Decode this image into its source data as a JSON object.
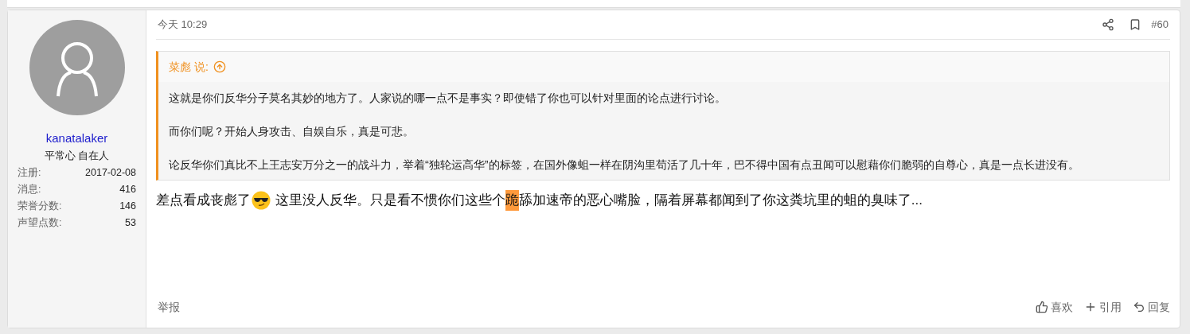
{
  "user": {
    "name": "kanatalaker",
    "title": "平常心 自在人",
    "stats": [
      {
        "label": "注册:",
        "value": "2017-02-08"
      },
      {
        "label": "消息:",
        "value": "416"
      },
      {
        "label": "荣誉分数:",
        "value": "146"
      },
      {
        "label": "声望点数:",
        "value": "53"
      }
    ]
  },
  "post": {
    "time": "今天 10:29",
    "number": "#60",
    "quote": {
      "author": "菜彪 说:",
      "paragraphs": [
        "这就是你们反华分子莫名其妙的地方了。人家说的哪一点不是事实？即使错了你也可以针对里面的论点进行讨论。",
        "而你们呢？开始人身攻击、自娱自乐，真是可悲。",
        "论反华你们真比不上王志安万分之一的战斗力，举着“独轮运高华”的标签，在国外像蛆一样在阴沟里苟活了几十年，巴不得中国有点丑闻可以慰藉你们脆弱的自尊心，真是一点长进没有。"
      ]
    },
    "body": [
      {
        "kind": "text",
        "text": "差点看成丧彪了"
      },
      {
        "kind": "emoji"
      },
      {
        "kind": "text",
        "text": " 这里没人反华。只是看不惯你们这些个"
      },
      {
        "kind": "highlight",
        "text": "跪"
      },
      {
        "kind": "text",
        "text": "舔加速帝的恶心嘴脸，隔着屏幕都闻到了你这粪坑里的蛆的臭味了..."
      }
    ],
    "report": "举报",
    "actions": [
      {
        "kind": "like",
        "label": "喜欢"
      },
      {
        "kind": "quote",
        "label": "引用"
      },
      {
        "kind": "reply",
        "label": "回复"
      }
    ]
  }
}
